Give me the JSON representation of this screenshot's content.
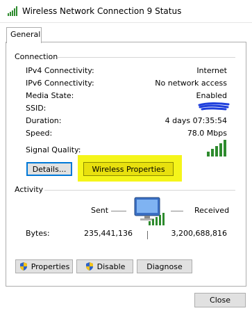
{
  "window": {
    "title": "Wireless Network Connection 9 Status",
    "icon": "signal-bars-icon"
  },
  "tabs": [
    {
      "label": "General",
      "active": true
    }
  ],
  "connection": {
    "heading": "Connection",
    "rows": [
      {
        "label": "IPv4 Connectivity:",
        "value": "Internet"
      },
      {
        "label": "IPv6 Connectivity:",
        "value": "No network access"
      },
      {
        "label": "Media State:",
        "value": "Enabled"
      },
      {
        "label": "SSID:",
        "value": ""
      },
      {
        "label": "Duration:",
        "value": "4 days 07:35:54"
      },
      {
        "label": "Speed:",
        "value": "78.0 Mbps"
      }
    ],
    "signal_quality_label": "Signal Quality:",
    "signal_bars_lit": 5,
    "signal_bars_total": 5,
    "details_button": "Details...",
    "wireless_properties_button": "Wireless Properties"
  },
  "activity": {
    "heading": "Activity",
    "sent_label": "Sent",
    "received_label": "Received",
    "bytes_label": "Bytes:",
    "bytes_sent": "235,441,136",
    "bytes_received": "3,200,688,816"
  },
  "actions": {
    "properties_button": "Properties",
    "disable_button": "Disable",
    "diagnose_button": "Diagnose"
  },
  "footer": {
    "close_button": "Close"
  },
  "colors": {
    "accent": "#0078d7",
    "highlight": "#f5f51a",
    "signal_green": "#2e8b2e",
    "redaction": "#1f3fdc"
  }
}
